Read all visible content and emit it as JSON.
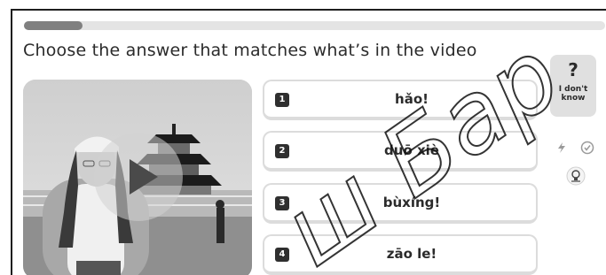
{
  "progress": {
    "value": 0.1
  },
  "question": "Choose the answer that matches what’s in the video",
  "video": {
    "play_icon": "play-icon",
    "scene": "person in front of temple"
  },
  "options": [
    {
      "number": "1",
      "text": "hǎo!"
    },
    {
      "number": "2",
      "text": "duō xiè"
    },
    {
      "number": "3",
      "text": "bùxíng!"
    },
    {
      "number": "4",
      "text": "zāo le!"
    }
  ],
  "idk": {
    "symbol": "?",
    "label": "I don't\nknow"
  },
  "side_icons": [
    "lightning-icon",
    "check-circle-icon",
    "lightbulb-icon"
  ],
  "watermark": "ш Бар",
  "colors": {
    "progress_fill": "#808080",
    "badge": "#2f2f2f",
    "idk_bg": "#e0e0e0"
  }
}
